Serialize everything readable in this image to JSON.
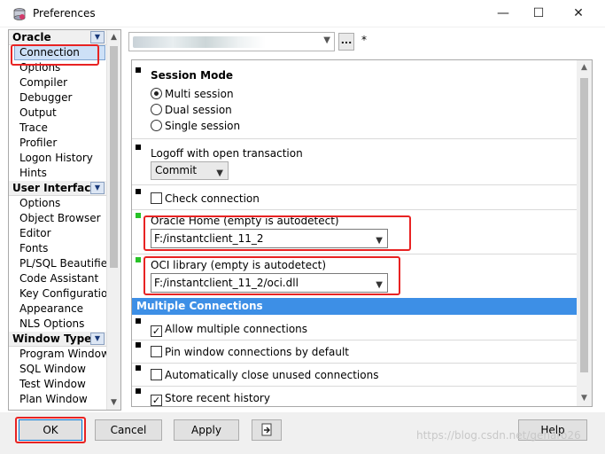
{
  "window": {
    "title": "Preferences",
    "minimize": "—",
    "maximize": "☐",
    "close": "✕"
  },
  "sidebar": {
    "groups": [
      {
        "label": "Oracle",
        "items": [
          "Connection",
          "Options",
          "Compiler",
          "Debugger",
          "Output",
          "Trace",
          "Profiler",
          "Logon History",
          "Hints"
        ]
      },
      {
        "label": "User Interface",
        "items": [
          "Options",
          "Object Browser",
          "Editor",
          "Fonts",
          "PL/SQL Beautifier",
          "Code Assistant",
          "Key Configuration",
          "Appearance",
          "NLS Options"
        ]
      },
      {
        "label": "Window Types",
        "items": [
          "Program Window",
          "SQL Window",
          "Test Window",
          "Plan Window"
        ]
      }
    ],
    "selected_item": "Connection"
  },
  "profile": {
    "dots_label": "...",
    "modified_marker": "*"
  },
  "session_mode": {
    "title": "Session Mode",
    "options": [
      "Multi session",
      "Dual session",
      "Single session"
    ],
    "selected": "Multi session"
  },
  "logoff": {
    "label": "Logoff with open transaction",
    "value": "Commit"
  },
  "check_connection": {
    "label": "Check connection",
    "checked": false
  },
  "oracle_home": {
    "label": "Oracle Home (empty is autodetect)",
    "value": "F:/instantclient_11_2"
  },
  "oci_library": {
    "label": "OCI library (empty is autodetect)",
    "value": "F:/instantclient_11_2/oci.dll"
  },
  "multiple_connections": {
    "title": "Multiple Connections",
    "options": [
      {
        "label": "Allow multiple connections",
        "checked": true,
        "mark": "✓"
      },
      {
        "label": "Pin window connections by default",
        "checked": false,
        "mark": ""
      },
      {
        "label": "Automatically close unused connections",
        "checked": false,
        "mark": ""
      },
      {
        "label": "Store recent history",
        "checked": true,
        "mark": "✓"
      }
    ]
  },
  "buttons": {
    "ok": "OK",
    "cancel": "Cancel",
    "apply": "Apply",
    "help": "Help"
  },
  "watermark": "https://blog.csdn.net/genaro26",
  "colors": {
    "highlight": "#e82323",
    "section_bar": "#3d8fe6",
    "selection": "#cde0f7"
  }
}
